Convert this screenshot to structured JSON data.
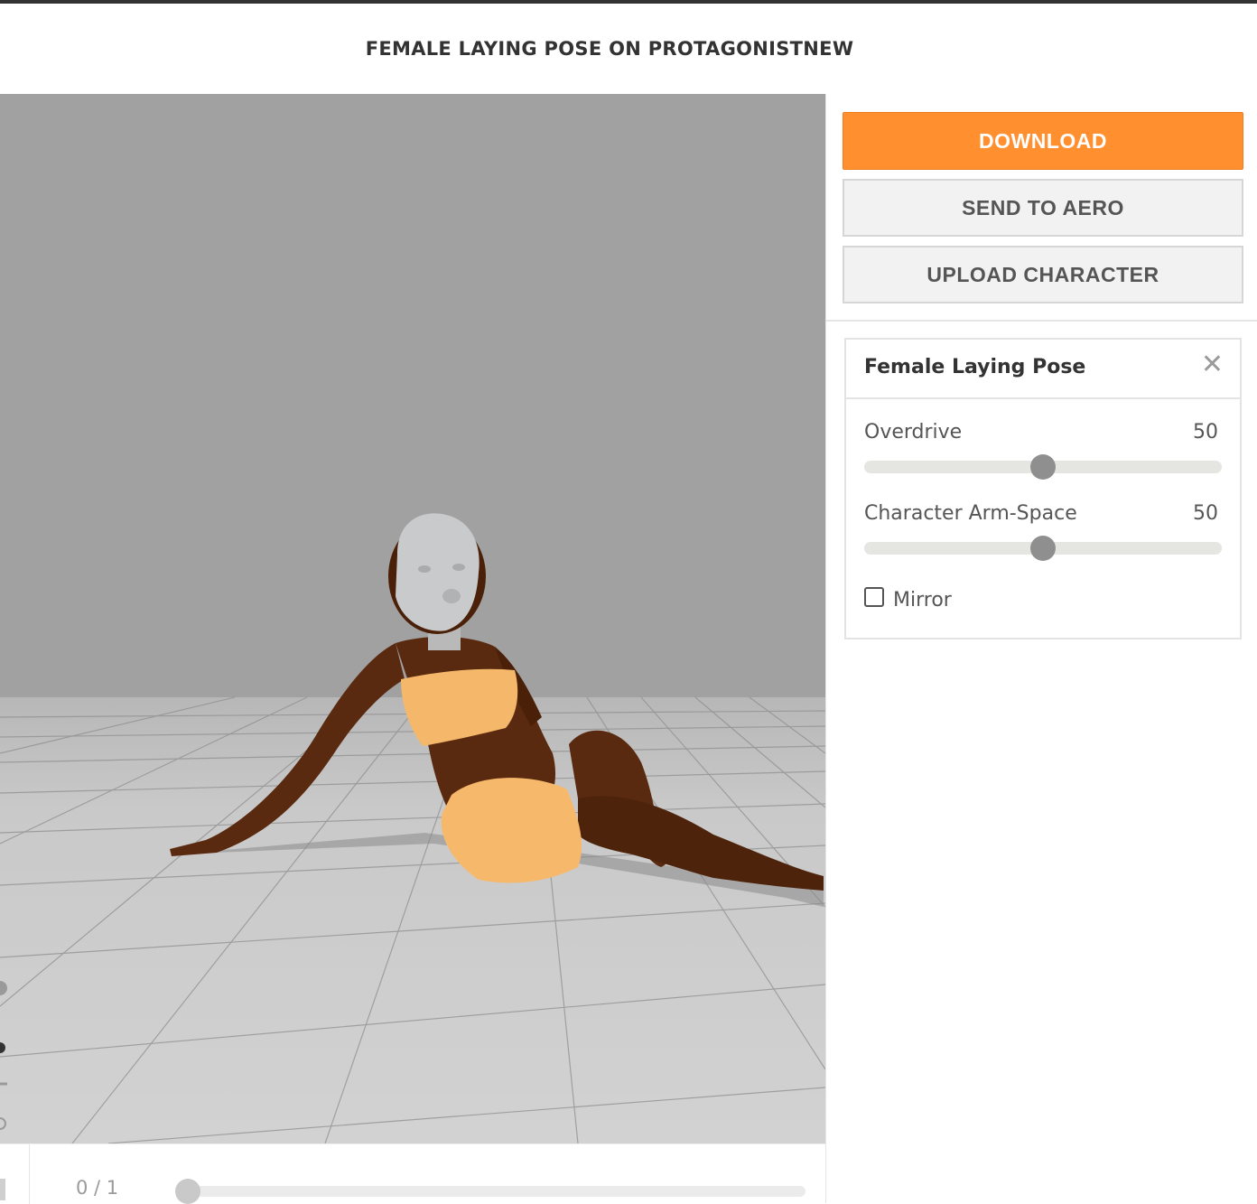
{
  "page": {
    "title": "FEMALE LAYING POSE ON PROTAGONISTNEW"
  },
  "timeline": {
    "frame": "0 / 1",
    "progress": 0
  },
  "actions": {
    "download": "DOWNLOAD",
    "send_to_aero": "SEND TO AERO",
    "upload_character": "UPLOAD CHARACTER"
  },
  "animation_panel": {
    "title": "Female Laying Pose",
    "close_icon": "close-icon",
    "sliders": [
      {
        "label": "Overdrive",
        "value": "50"
      },
      {
        "label": "Character Arm-Space",
        "value": "50"
      }
    ],
    "mirror": {
      "label": "Mirror",
      "checked": false
    }
  },
  "colors": {
    "accent": "#ff8f2f",
    "viewport_backdrop": "#a1a1a1",
    "floor": "#cfcfcf",
    "skin": "#5a2a10",
    "clothing": "#f5b86a",
    "head": "#c8cacc"
  },
  "icons": [
    "close-icon",
    "checkbox-icon",
    "orbit-icon",
    "zoom-icon",
    "play-icon"
  ]
}
